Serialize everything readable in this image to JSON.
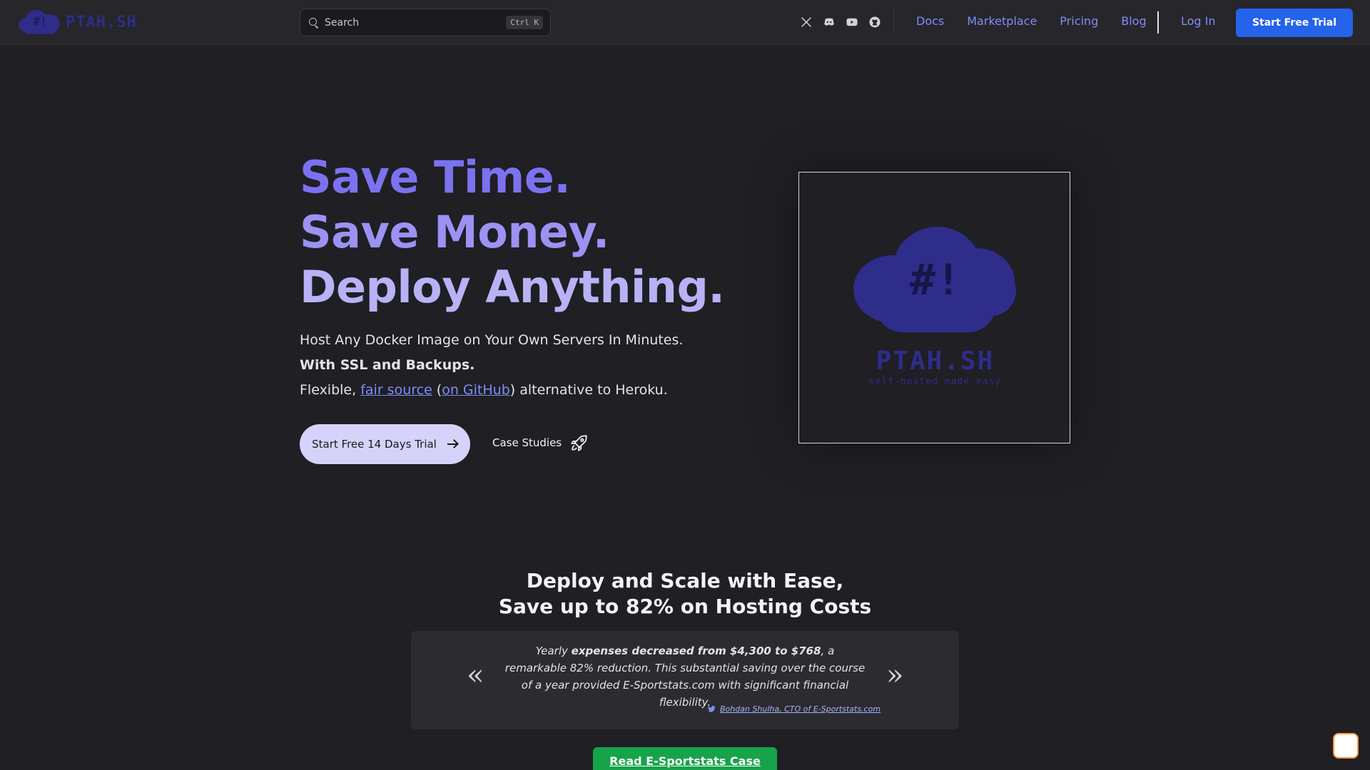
{
  "brand": {
    "logo_mark": "#!",
    "logo_text": "PTAH.SH"
  },
  "search": {
    "placeholder": "Search",
    "shortcut": "Ctrl K"
  },
  "social": [
    "x-icon",
    "discord-icon",
    "youtube-icon",
    "github-icon"
  ],
  "nav": {
    "docs": "Docs",
    "marketplace": "Marketplace",
    "pricing": "Pricing",
    "blog": "Blog",
    "login": "Log In",
    "trial": "Start Free Trial"
  },
  "hero": {
    "line1": "Save Time.",
    "line2": "Save Money.",
    "line3": "Deploy Anything.",
    "sub1": "Host Any Docker Image on Your Own Servers In Minutes.",
    "sub2": "With SSL and Backups.",
    "sub3_pre": "Flexible, ",
    "sub3_link1": "fair source",
    "sub3_mid1": " (",
    "sub3_link2": "on GitHub",
    "sub3_post": ") alternative to Heroku.",
    "cta": "Start Free 14 Days Trial",
    "case_studies": "Case Studies",
    "image": {
      "mark": "#!",
      "title": "PTAH.SH",
      "tagline": "self-hosted made easy"
    }
  },
  "savings": {
    "title_line1": "Deploy and Scale with Ease,",
    "title_line2": "Save up to 82% on Hosting Costs",
    "prev": "«",
    "next": "»",
    "quote_pre": "Yearly ",
    "quote_bold": "expenses decreased from $4,300 to $768",
    "quote_post": ", a remarkable 82% reduction. This substantial saving over the course of a year provided E-Sportstats.com with significant financial flexibility.",
    "author": "Bohdan Shulha, CTO of E-Sportstats.com",
    "read_button": "Read E-Sportstats Case Study"
  },
  "colors": {
    "accent": "#818cf8",
    "primary_button": "#2563eb",
    "read_button": "#16a34a",
    "brand_blue": "#2e2d8a"
  }
}
